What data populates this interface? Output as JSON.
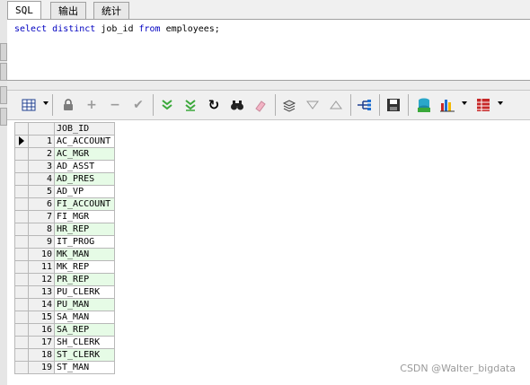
{
  "tabs": [
    {
      "label": "SQL",
      "active": true
    },
    {
      "label": "输出",
      "active": false
    },
    {
      "label": "统计",
      "active": false
    }
  ],
  "editor": {
    "tokens": [
      {
        "text": "select",
        "kw": true
      },
      {
        "text": " ",
        "kw": false
      },
      {
        "text": "distinct",
        "kw": true
      },
      {
        "text": " job_id ",
        "kw": false
      },
      {
        "text": "from",
        "kw": true
      },
      {
        "text": " employees;",
        "kw": false
      }
    ]
  },
  "toolbar": {
    "icons": [
      "grid-view-icon",
      "lock-icon",
      "add-record-icon",
      "delete-record-icon",
      "post-check-icon",
      "fetch-next-icon",
      "fetch-last-icon",
      "refresh-icon",
      "find-icon",
      "clear-icon",
      "query-by-example-icon",
      "filter-down-icon",
      "filter-up-icon",
      "link-icon",
      "save-icon",
      "export-icon",
      "chart-icon",
      "report-icon"
    ],
    "colors": {
      "green": "#3aa83a",
      "gray": "#9a9a9a",
      "red": "#c62828",
      "blue": "#1f6fd1"
    }
  },
  "grid": {
    "column": "JOB_ID",
    "rows": [
      {
        "n": "1",
        "v": "AC_ACCOUNT"
      },
      {
        "n": "2",
        "v": "AC_MGR"
      },
      {
        "n": "3",
        "v": "AD_ASST"
      },
      {
        "n": "4",
        "v": "AD_PRES"
      },
      {
        "n": "5",
        "v": "AD_VP"
      },
      {
        "n": "6",
        "v": "FI_ACCOUNT"
      },
      {
        "n": "7",
        "v": "FI_MGR"
      },
      {
        "n": "8",
        "v": "HR_REP"
      },
      {
        "n": "9",
        "v": "IT_PROG"
      },
      {
        "n": "10",
        "v": "MK_MAN"
      },
      {
        "n": "11",
        "v": "MK_REP"
      },
      {
        "n": "12",
        "v": "PR_REP"
      },
      {
        "n": "13",
        "v": "PU_CLERK"
      },
      {
        "n": "14",
        "v": "PU_MAN"
      },
      {
        "n": "15",
        "v": "SA_MAN"
      },
      {
        "n": "16",
        "v": "SA_REP"
      },
      {
        "n": "17",
        "v": "SH_CLERK"
      },
      {
        "n": "18",
        "v": "ST_CLERK"
      },
      {
        "n": "19",
        "v": "ST_MAN"
      }
    ],
    "current_row": 1,
    "alt_color": "#e6fbe6"
  },
  "watermark": "CSDN @Walter_bigdata"
}
